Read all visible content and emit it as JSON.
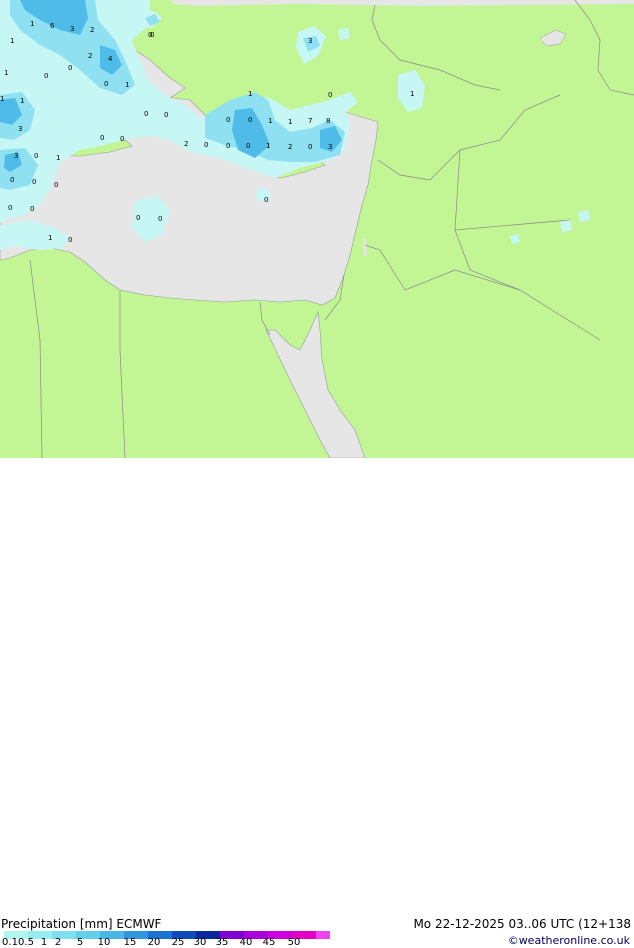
{
  "footer": {
    "title": "Precipitation [mm]  ECMWF",
    "datetime": "Mo 22-12-2025 03..06 UTC (12+138",
    "credit": "©weatheronline.co.uk"
  },
  "legend": {
    "ticks": [
      "0.1",
      "0.5",
      "1",
      "2",
      "5",
      "10",
      "15",
      "20",
      "25",
      "30",
      "35",
      "40",
      "45",
      "50"
    ],
    "colors": [
      "#aff5f0",
      "#96eef0",
      "#7ee0ee",
      "#5fcfea",
      "#47b7e6",
      "#3097dc",
      "#1a72d2",
      "#0d4bbd",
      "#07279c",
      "#7e00d2",
      "#a900dc",
      "#cc00dc",
      "#e000c8",
      "#f040f0"
    ]
  },
  "map_colors": {
    "land": "#c2f593",
    "sea": "#e6e6e6",
    "precip_light": "#c6f7f5",
    "precip_medium": "#8fe1f2",
    "precip_heavy": "#4fbbe8"
  },
  "precip_labels": [
    "1",
    "6",
    "3",
    "2",
    "0",
    "1",
    "2",
    "4",
    "0",
    "1",
    "0",
    "0",
    "1",
    "1",
    "1",
    "0",
    "0",
    "3",
    "0",
    "0",
    "1",
    "1",
    "0",
    "0",
    "1",
    "1",
    "7",
    "8",
    "3",
    "0",
    "0",
    "2",
    "0",
    "0",
    "0",
    "1",
    "2",
    "0",
    "3",
    "3",
    "0",
    "1",
    "0",
    "0",
    "0",
    "0",
    "0",
    "0",
    "0",
    "0",
    "1",
    "0"
  ]
}
